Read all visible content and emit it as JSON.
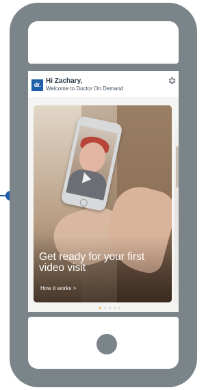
{
  "app": {
    "logo_text": "dr.",
    "greeting": "Hi Zachary,",
    "welcome": "Welcome to Doctor On Demand",
    "settings_icon": "gear-icon"
  },
  "card": {
    "title": "Get ready for your first video visit",
    "link": "How it works >",
    "play_icon": "play-icon"
  },
  "pagination": {
    "count": 5,
    "active_index": 0
  },
  "colors": {
    "brand_blue": "#1f5ea8",
    "phone_frame": "#7a8489",
    "active_dot": "#f0b03a"
  }
}
